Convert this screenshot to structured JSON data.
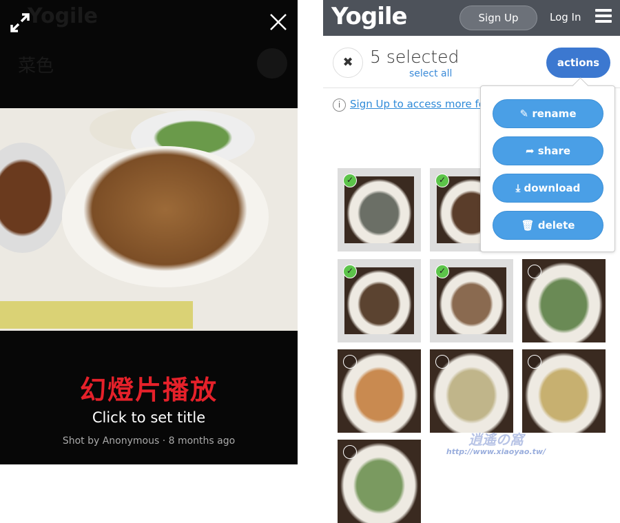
{
  "viewer": {
    "ghost_logo": "Yogile",
    "ghost_album": "菜色",
    "slideshow_label": "幻燈片播放",
    "title": "Click to set title",
    "credit": "Shot by Anonymous · 8 months ago"
  },
  "header": {
    "logo": "Yogile",
    "signup": "Sign Up",
    "login": "Log In"
  },
  "selection": {
    "count": "5 selected",
    "select_all": "select all",
    "actions": "actions"
  },
  "info": {
    "text": "Sign Up to access more fe"
  },
  "menu": [
    {
      "label": "rename",
      "icon": "✎"
    },
    {
      "label": "share",
      "icon": "➦"
    },
    {
      "label": "download",
      "icon": "⤓"
    },
    {
      "label": "delete",
      "icon": "🗑"
    }
  ],
  "thumbs": [
    {
      "selected": true,
      "color": "#6b6f66"
    },
    {
      "selected": true,
      "color": "#5a3d2a"
    },
    {
      "selected": false,
      "color": "#8a7a60"
    },
    {
      "selected": true,
      "color": "#5b4330"
    },
    {
      "selected": true,
      "color": "#8a6a50"
    },
    {
      "selected": false,
      "color": "#6a8a55"
    },
    {
      "selected": false,
      "color": "#c98a50"
    },
    {
      "selected": false,
      "color": "#c0b58a"
    },
    {
      "selected": false,
      "color": "#c7b070"
    },
    {
      "selected": false,
      "color": "#7a9a60"
    }
  ],
  "watermark": {
    "title": "逍遙の窩",
    "url": "http://www.xiaoyao.tw/"
  }
}
